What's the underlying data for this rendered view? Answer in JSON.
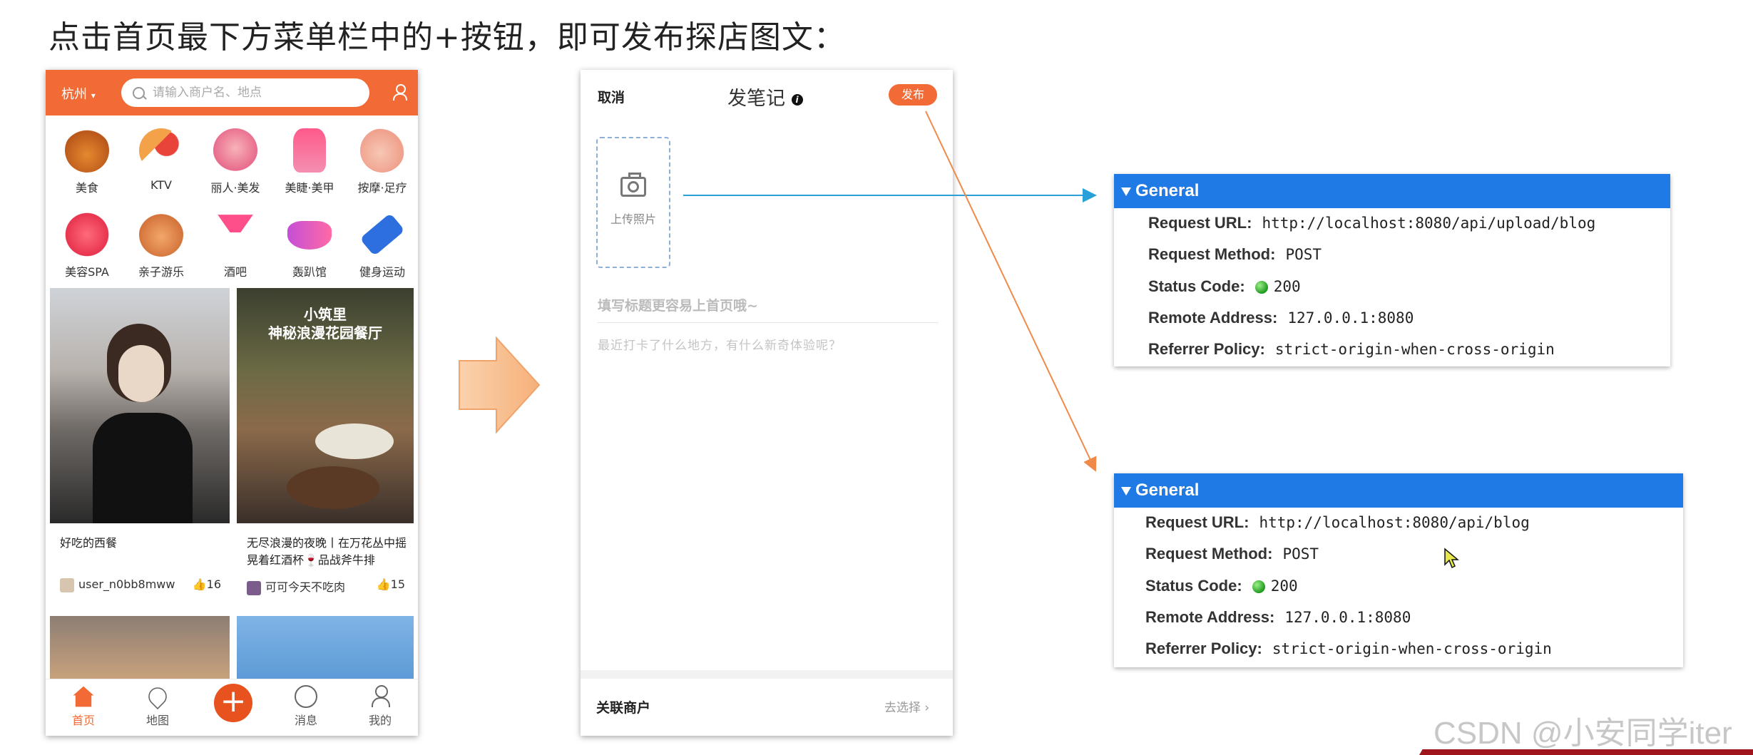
{
  "heading": "点击首页最下方菜单栏中的+按钮，即可发布探店图文：",
  "app": {
    "city": "杭州",
    "search_placeholder": "请输入商户名、地点",
    "categories": [
      {
        "label": "美食",
        "icon": "roast-chicken-icon"
      },
      {
        "label": "KTV",
        "icon": "microphone-icon"
      },
      {
        "label": "丽人·美发",
        "icon": "hair-icon"
      },
      {
        "label": "美睫·美甲",
        "icon": "nail-icon"
      },
      {
        "label": "按摩·足疗",
        "icon": "massage-icon"
      },
      {
        "label": "美容SPA",
        "icon": "face-mask-icon"
      },
      {
        "label": "亲子游乐",
        "icon": "parent-child-icon"
      },
      {
        "label": "酒吧",
        "icon": "cocktail-icon"
      },
      {
        "label": "轰趴馆",
        "icon": "party-mask-icon"
      },
      {
        "label": "健身运动",
        "icon": "dumbbell-icon"
      }
    ],
    "cards": [
      {
        "title": "好吃的西餐",
        "user": "user_n0bb8mww",
        "likes": "16"
      },
      {
        "title": "无尽浪漫的夜晚丨在万花丛中摇晃着红酒杯🍷品战斧牛排",
        "image_text": "小筑里\n神秘浪漫花园餐厅",
        "user": "可可今天不吃肉",
        "likes": "15"
      }
    ],
    "nav": [
      {
        "label": "首页",
        "icon": "home-icon"
      },
      {
        "label": "地图",
        "icon": "map-pin-icon"
      },
      {
        "label": "+",
        "icon": "plus-icon"
      },
      {
        "label": "消息",
        "icon": "chat-icon"
      },
      {
        "label": "我的",
        "icon": "user-icon"
      }
    ]
  },
  "editor": {
    "cancel": "取消",
    "title": "发笔记",
    "publish": "发布",
    "upload_label": "上传照片",
    "title_placeholder": "填写标题更容易上首页哦~",
    "body_placeholder": "最近打卡了什么地方，有什么新奇体验呢？",
    "associate": "关联商户",
    "choose": "去选择"
  },
  "panels": [
    {
      "header": "General",
      "rows": [
        {
          "key": "Request URL:",
          "value": "http://localhost:8080/api/upload/blog"
        },
        {
          "key": "Request Method:",
          "value": "POST"
        },
        {
          "key": "Status Code:",
          "value": "200"
        },
        {
          "key": "Remote Address:",
          "value": "127.0.0.1:8080"
        },
        {
          "key": "Referrer Policy:",
          "value": "strict-origin-when-cross-origin"
        }
      ]
    },
    {
      "header": "General",
      "rows": [
        {
          "key": "Request URL:",
          "value": "http://localhost:8080/api/blog"
        },
        {
          "key": "Request Method:",
          "value": "POST"
        },
        {
          "key": "Status Code:",
          "value": "200"
        },
        {
          "key": "Remote Address:",
          "value": "127.0.0.1:8080"
        },
        {
          "key": "Referrer Policy:",
          "value": "strict-origin-when-cross-origin"
        }
      ]
    }
  ],
  "watermark": "CSDN @小安同学iter",
  "colors": {
    "accent": "#f26b36",
    "panel_header": "#1f7ae6",
    "status_ok": "#1e9a1e"
  }
}
